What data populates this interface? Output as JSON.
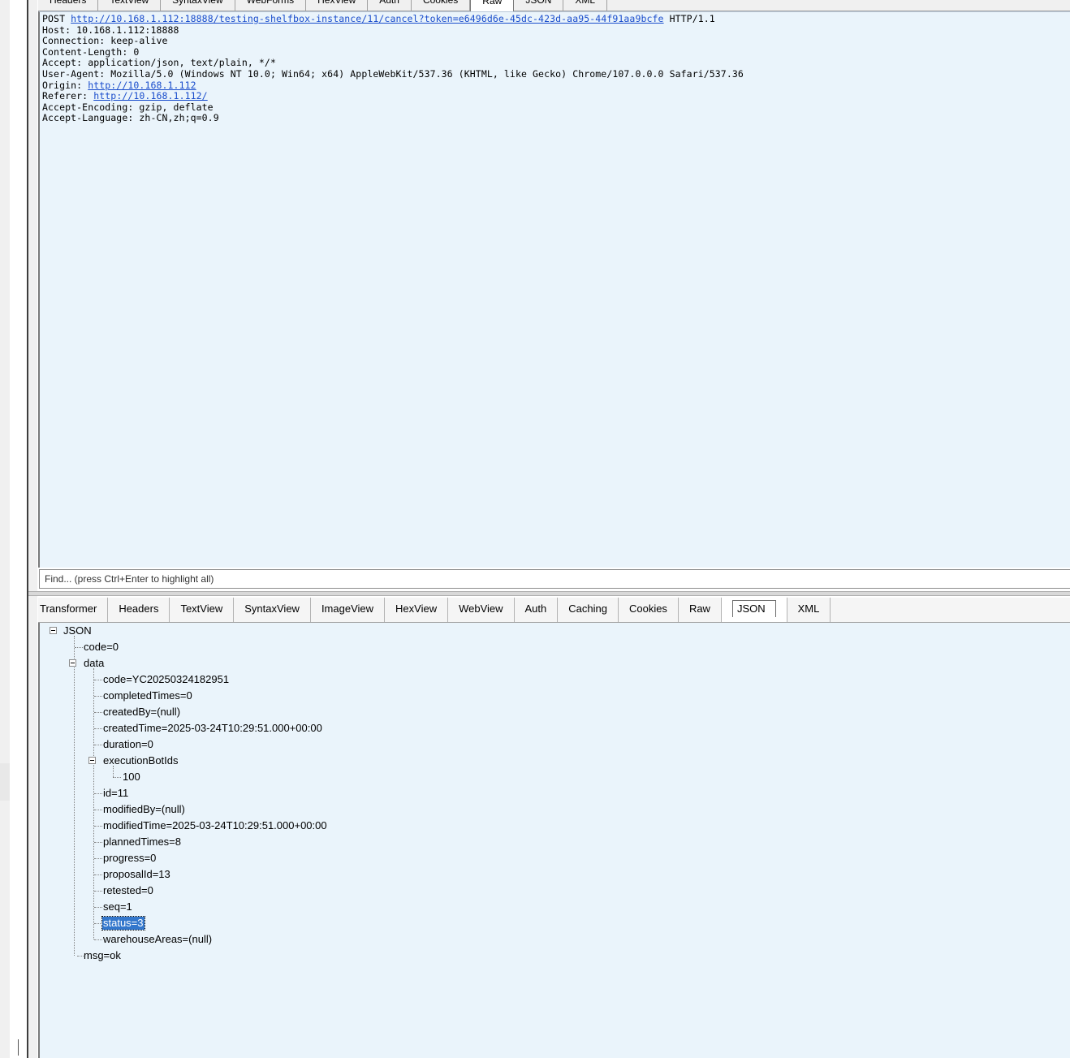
{
  "request": {
    "tabs": [
      "Headers",
      "TextView",
      "SyntaxView",
      "WebForms",
      "HexView",
      "Auth",
      "Cookies",
      "Raw",
      "JSON",
      "XML"
    ],
    "active_tab": "Raw",
    "raw_lines": [
      {
        "pre": "POST ",
        "link": "http://10.168.1.112:18888/testing-shelfbox-instance/11/cancel?token=e6496d6e-45dc-423d-aa95-44f91aa9bcfe",
        "post": " HTTP/1.1"
      },
      {
        "pre": "Host: 10.168.1.112:18888"
      },
      {
        "pre": "Connection: keep-alive"
      },
      {
        "pre": "Content-Length: 0"
      },
      {
        "pre": "Accept: application/json, text/plain, */*"
      },
      {
        "pre": "User-Agent: Mozilla/5.0 (Windows NT 10.0; Win64; x64) AppleWebKit/537.36 (KHTML, like Gecko) Chrome/107.0.0.0 Safari/537.36"
      },
      {
        "pre": "Origin: ",
        "link": "http://10.168.1.112"
      },
      {
        "pre": "Referer: ",
        "link": "http://10.168.1.112/"
      },
      {
        "pre": "Accept-Encoding: gzip, deflate"
      },
      {
        "pre": "Accept-Language: zh-CN,zh;q=0.9"
      }
    ]
  },
  "find": {
    "placeholder": "Find... (press Ctrl+Enter to highlight all)"
  },
  "response": {
    "tabs": [
      "Transformer",
      "Headers",
      "TextView",
      "SyntaxView",
      "ImageView",
      "HexView",
      "WebView",
      "Auth",
      "Caching",
      "Cookies",
      "Raw",
      "JSON",
      "XML"
    ],
    "active_tab": "JSON",
    "tree": {
      "root": "JSON",
      "code": "code=0",
      "data_label": "data",
      "data_items": [
        "code=YC20250324182951",
        "completedTimes=0",
        "createdBy=(null)",
        "createdTime=2025-03-24T10:29:51.000+00:00",
        "duration=0",
        "executionBotIds",
        "100",
        "id=11",
        "modifiedBy=(null)",
        "modifiedTime=2025-03-24T10:29:51.000+00:00",
        "plannedTimes=8",
        "progress=0",
        "proposalId=13",
        "retested=0",
        "seq=1",
        "status=3",
        "warehouseAreas=(null)"
      ],
      "msg": "msg=ok",
      "selected": "status=3"
    }
  }
}
